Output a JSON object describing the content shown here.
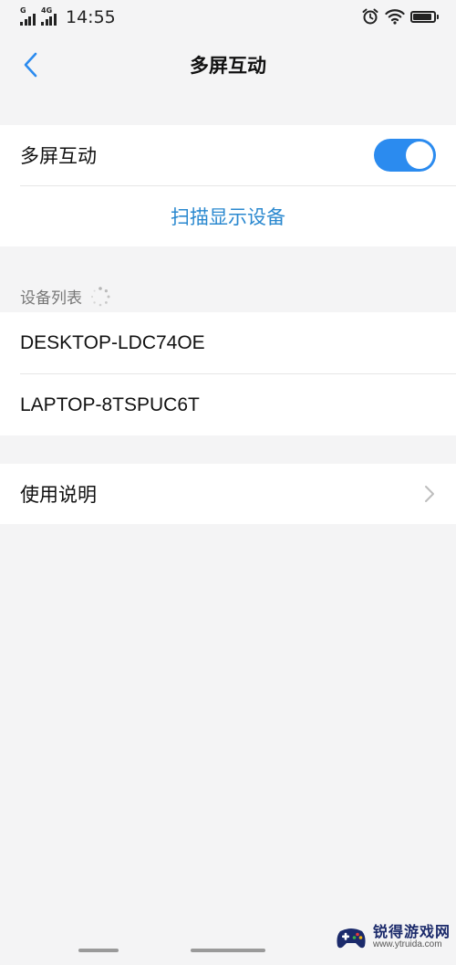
{
  "status_bar": {
    "signal1_tag": "G",
    "signal2_tag": "4G",
    "time": "14:55",
    "icons": [
      "signal-icon",
      "signal-4g-icon",
      "alarm-icon",
      "wifi-icon",
      "battery-icon"
    ],
    "battery_level": 0.9
  },
  "nav": {
    "title": "多屏互动",
    "back_icon": "chevron-left-icon"
  },
  "settings": {
    "toggle_label": "多屏互动",
    "toggle_on": true,
    "scan_label": "扫描显示设备"
  },
  "device_section": {
    "header": "设备列表",
    "devices": [
      {
        "name": "DESKTOP-LDC74OE"
      },
      {
        "name": "LAPTOP-8TSPUC6T"
      }
    ]
  },
  "help": {
    "label": "使用说明"
  },
  "watermark": {
    "title": "锐得游戏网",
    "url": "www.ytruida.com"
  },
  "colors": {
    "accent": "#2b8bef",
    "link": "#2a88cf",
    "background": "#f4f4f5",
    "card": "#ffffff"
  }
}
